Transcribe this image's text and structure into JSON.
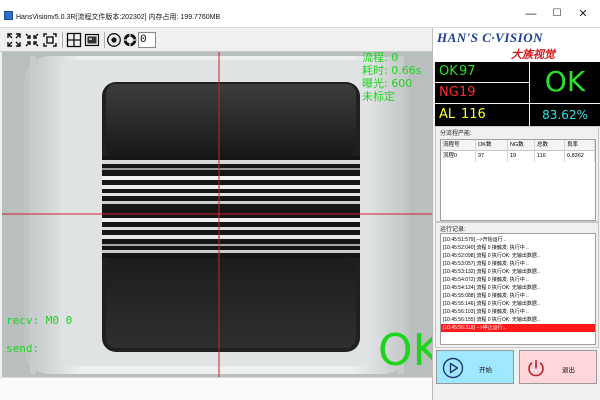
{
  "window": {
    "title": "HansVisionv5.0.3R[流程文件版本:202302] 内存占用: 199.7760MB",
    "minimize": "—",
    "maximize": "☐",
    "close": "✕"
  },
  "toolbar": {
    "icons": [
      "fit-icon",
      "collapse-icon",
      "frame-icon",
      "crosshair-icon",
      "image-icon",
      "camera-icon",
      "aperture-icon"
    ],
    "zoom_value": "0"
  },
  "camera": {
    "overlay": {
      "flow": "流程: 0",
      "time": "耗时: 0.66s",
      "exposure": "曝光: 600",
      "calibration": "未标定",
      "recv": "recv: M0 0",
      "send": "send:",
      "result": "OK"
    },
    "overlay_color": "#1fd41f",
    "crosshair_color": "#d0202a"
  },
  "brand": {
    "name_en": "HAN'S C·VISION",
    "name_cn": "大族视觉"
  },
  "stats": {
    "ok_label": "OK",
    "ok_value": "97",
    "ng_label": "NG",
    "ng_value": "19",
    "al_label": "AL",
    "al_value": "116",
    "result": "OK",
    "yield_rate": "83.62%"
  },
  "flow_stats": {
    "title": "分流程产能:",
    "columns": [
      "流程号",
      "OK数",
      "NG数",
      "总数",
      "良率"
    ],
    "rows": [
      [
        "流程0",
        "97",
        "19",
        "116",
        "0.8362"
      ]
    ]
  },
  "log": {
    "title": "运行记录:",
    "lines": [
      {
        "text": "[10:45:51:579] -->开始运行←",
        "level": "info"
      },
      {
        "text": "[10:45:52:040] 流程 0 接触发: 执行中←",
        "level": "info"
      },
      {
        "text": "[10:45:52:098] 流程 0 执行OK: 无输出数据←",
        "level": "info"
      },
      {
        "text": "[10:45:53:057] 流程 0 接触发: 执行中←",
        "level": "info"
      },
      {
        "text": "[10:45:53:132] 流程 0 执行OK: 无输出数据←",
        "level": "info"
      },
      {
        "text": "[10:45:54:072] 流程 0 接触发: 执行中←",
        "level": "info"
      },
      {
        "text": "[10:45:54:124] 流程 0 执行OK: 无输出数据←",
        "level": "info"
      },
      {
        "text": "[10:45:55:088] 流程 0 接触发: 执行中←",
        "level": "info"
      },
      {
        "text": "[10:45:55:146] 流程 0 执行OK: 无输出数据←",
        "level": "info"
      },
      {
        "text": "[10:45:56:103] 流程 0 接触发: 执行中←",
        "level": "info"
      },
      {
        "text": "[10:45:56:155] 流程 0 执行OK: 无输出数据←",
        "level": "info"
      },
      {
        "text": "[10:45:56:318] -->停止运行←",
        "level": "error"
      }
    ]
  },
  "buttons": {
    "start": "开始",
    "exit": "退出"
  },
  "colors": {
    "ok_green": "#2be02b",
    "ng_red": "#ff2a2a",
    "al_yellow": "#ffff2e",
    "rate_cyan": "#2ee6e6",
    "brand_blue": "#1d3c8f",
    "brand_red": "#d71920",
    "start_button": "#9fe6ff",
    "exit_button": "#ffd6dc"
  }
}
